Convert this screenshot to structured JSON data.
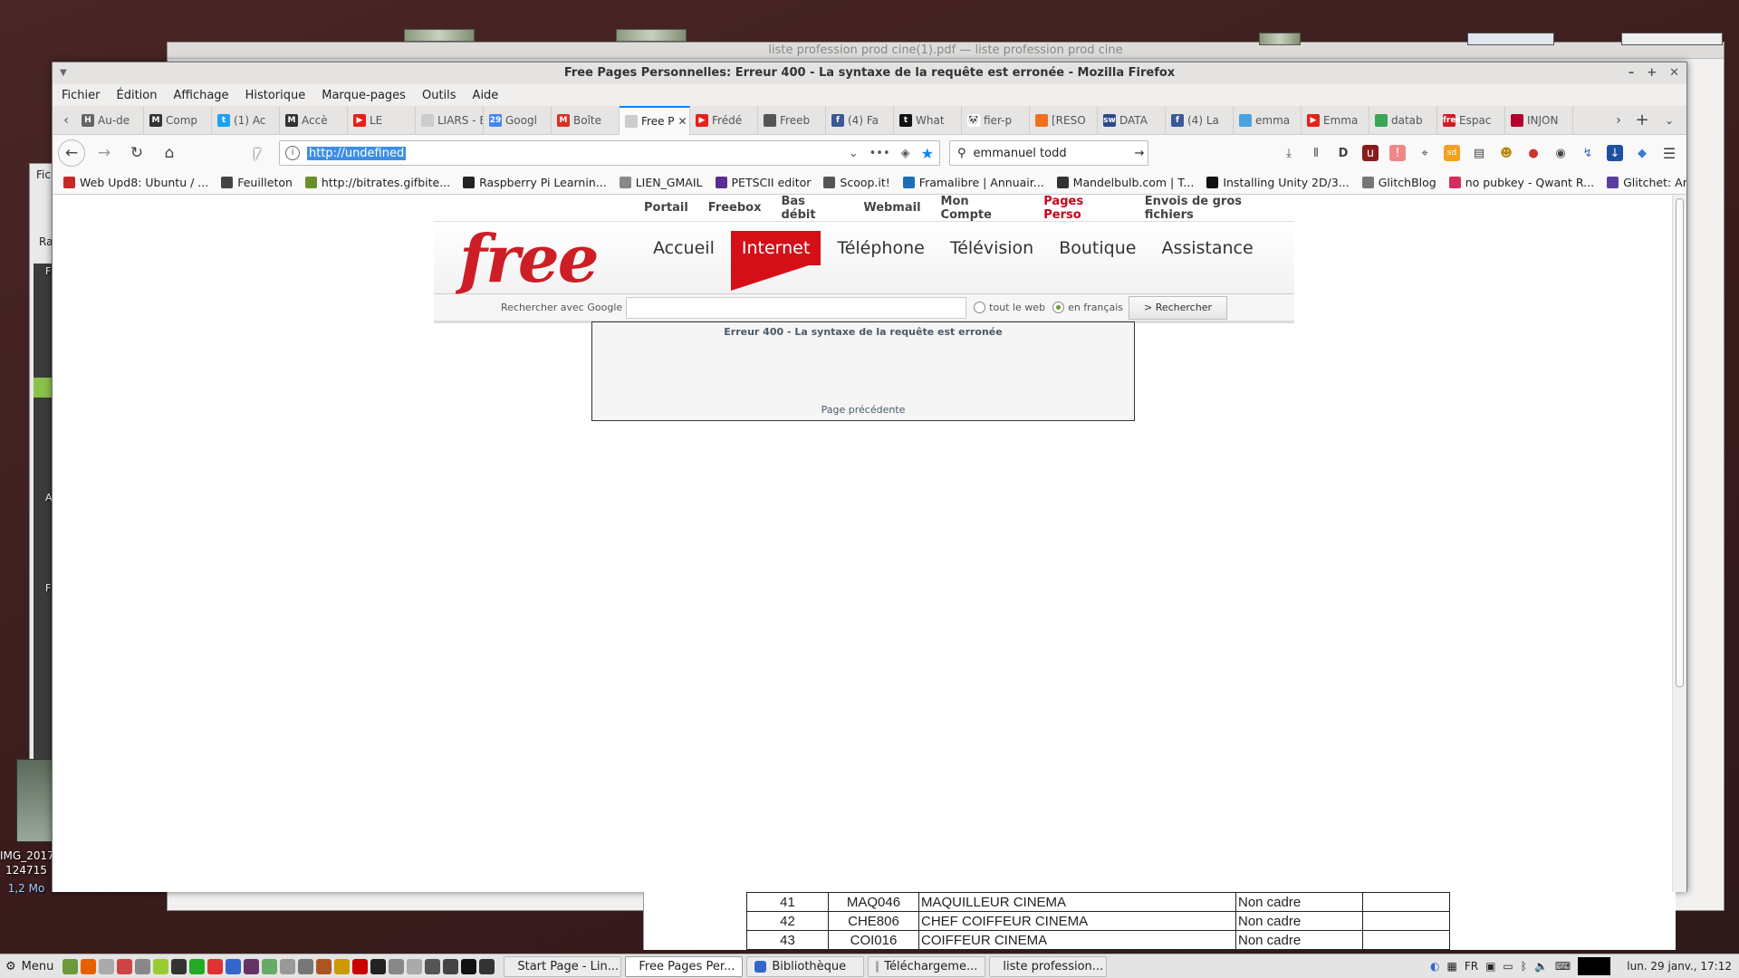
{
  "desktop": {
    "bg_window_title": "liste profession prod cine(1).pdf — liste profession prod cine",
    "desk_icon_label_1": "IMG_2017",
    "desk_icon_label_2": "124715",
    "desk_icon_label_3": "1,2 Mo",
    "side_fragments": [
      "Fic",
      "Ra",
      "F",
      "A",
      "F"
    ]
  },
  "firefox": {
    "window_title": "Free Pages Personnelles: Erreur 400 - La syntaxe de la requête est erronée - Mozilla Firefox",
    "menu": [
      "Fichier",
      "Édition",
      "Affichage",
      "Historique",
      "Marque-pages",
      "Outils",
      "Aide"
    ],
    "tabs": [
      {
        "label": "Au-de",
        "icon": "H",
        "color": "#666666"
      },
      {
        "label": "Comp",
        "icon": "M",
        "color": "#333333"
      },
      {
        "label": "(1) Ac",
        "icon": "t",
        "color": "#1da1f2"
      },
      {
        "label": "Accè",
        "icon": "M",
        "color": "#333333"
      },
      {
        "label": "LE",
        "icon": "▶",
        "color": "#e62117"
      },
      {
        "label": "LIARS - Ea",
        "icon": "",
        "color": "#cccccc"
      },
      {
        "label": "Googl",
        "icon": "29",
        "color": "#4285f4"
      },
      {
        "label": "Boîte",
        "icon": "M",
        "color": "#d93025"
      },
      {
        "label": "Free P",
        "icon": "",
        "color": "#cccccc"
      },
      {
        "label": "Frédé",
        "icon": "▶",
        "color": "#e62117"
      },
      {
        "label": "Freeb",
        "icon": "",
        "color": "#555555"
      },
      {
        "label": "(4) Fa",
        "icon": "f",
        "color": "#3b5998"
      },
      {
        "label": "What",
        "icon": "t",
        "color": "#111111"
      },
      {
        "label": "fier-p",
        "icon": "🐼",
        "color": "#ffffff"
      },
      {
        "label": "[RESO",
        "icon": "",
        "color": "#f07020"
      },
      {
        "label": "DATA",
        "icon": "sw",
        "color": "#2b4a8a"
      },
      {
        "label": "(4) La",
        "icon": "f",
        "color": "#3b5998"
      },
      {
        "label": "emma",
        "icon": "",
        "color": "#4aa3df"
      },
      {
        "label": "Emma",
        "icon": "▶",
        "color": "#e62117"
      },
      {
        "label": "datab",
        "icon": "",
        "color": "#3aa655"
      },
      {
        "label": "Espac",
        "icon": "free",
        "color": "#cd1e25"
      },
      {
        "label": "INJON",
        "icon": "",
        "color": "#b3002d"
      }
    ],
    "url": "http://undefined",
    "search_value": "emmanuel todd",
    "bookmarks": [
      {
        "label": "Web Upd8: Ubuntu / ...",
        "color": "#c62828"
      },
      {
        "label": "Feuilleton",
        "color": "#444444"
      },
      {
        "label": "http://bitrates.gifbite...",
        "color": "#6a8f2a"
      },
      {
        "label": "Raspberry Pi Learnin...",
        "color": "#222222"
      },
      {
        "label": "LIEN_GMAIL",
        "color": "#888888"
      },
      {
        "label": "PETSCII editor",
        "color": "#5a2d91"
      },
      {
        "label": "Scoop.it!",
        "color": "#555555"
      },
      {
        "label": "Framalibre | Annuair...",
        "color": "#1f6eb5"
      },
      {
        "label": "Mandelbulb.com | T...",
        "color": "#333333"
      },
      {
        "label": "Installing Unity 2D/3...",
        "color": "#111111"
      },
      {
        "label": "GlitchBlog",
        "color": "#777777"
      },
      {
        "label": "no pubkey - Qwant R...",
        "color": "#d62d5f"
      },
      {
        "label": "Glitchet: Art Resources",
        "color": "#5a3fa0"
      }
    ]
  },
  "free_page": {
    "top_links": [
      "Portail",
      "Freebox",
      "Bas débit",
      "Webmail",
      "Mon Compte",
      "Pages Perso",
      "Envois de gros fichiers"
    ],
    "highlight_index": 5,
    "logo": "free",
    "main_nav": [
      "Accueil",
      "Internet",
      "Téléphone",
      "Télévision",
      "Boutique",
      "Assistance"
    ],
    "active_nav": "Internet",
    "search_label": "Rechercher avec Google",
    "radio_web": "tout le web",
    "radio_fr": "en français",
    "search_button": "> Rechercher",
    "error_title": "Erreur 400 - La syntaxe de la requête est erronée",
    "error_link": "Page précédente"
  },
  "pdf_rows": [
    [
      "41",
      "MAQ046",
      "MAQUILLEUR CINEMA",
      "Non cadre"
    ],
    [
      "42",
      "CHE806",
      "CHEF COIFFEUR CINEMA",
      "Non cadre"
    ],
    [
      "43",
      "COI016",
      "COIFFEUR CINEMA",
      "Non cadre"
    ]
  ],
  "taskbar": {
    "menu_label": "Menu",
    "tasks": [
      {
        "label": "Start Page - Lin...",
        "active": false
      },
      {
        "label": "Free Pages Per...",
        "active": true
      },
      {
        "label": "Bibliothèque",
        "active": false
      },
      {
        "label": "Téléchargeme...",
        "active": false
      },
      {
        "label": "liste profession...",
        "active": false
      }
    ],
    "lang": "FR",
    "clock": "lun. 29 janv., 17:12"
  }
}
